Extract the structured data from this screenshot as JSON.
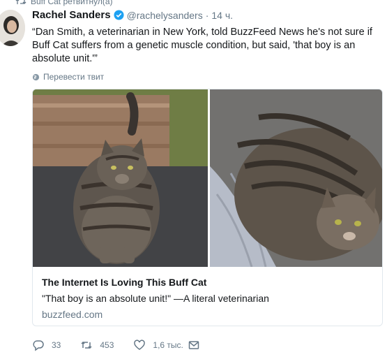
{
  "retweet": {
    "label": "Buff Cat ретвитнул(а)",
    "icon": "retweet-icon"
  },
  "tweet": {
    "author_name": "Rachel Sanders",
    "verified": true,
    "handle": "@rachelysanders",
    "separator": "·",
    "time": "14 ч.",
    "text": "“Dan Smith, a veterinarian in New York, told BuzzFeed News he's not sure if Buff Cat suffers from a genetic muscle condition, but said, 'that boy is an absolute unit.'”",
    "translate_label": "Перевести твит"
  },
  "card": {
    "title": "The Internet Is Loving This Buff Cat",
    "description": "\"That boy is an absolute unit!\" —A literal veterinarian",
    "domain": "buzzfeed.com"
  },
  "actions": {
    "reply_count": "33",
    "retweet_count": "453",
    "like_count": "1,6 тыс."
  },
  "colors": {
    "accent": "#1da1f2",
    "muted": "#657786",
    "text": "#14171a",
    "border": "#e1e8ed"
  }
}
